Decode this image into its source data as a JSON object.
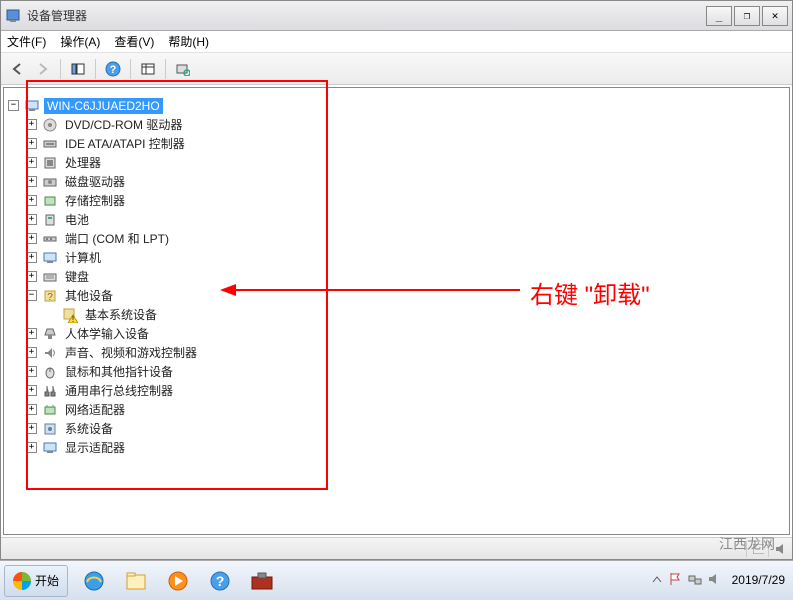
{
  "window": {
    "title": "设备管理器"
  },
  "menubar": {
    "file": "文件(F)",
    "action": "操作(A)",
    "view": "查看(V)",
    "help": "帮助(H)"
  },
  "tree": {
    "root": "WIN-C6JJUAED2HO",
    "items": [
      "DVD/CD-ROM 驱动器",
      "IDE ATA/ATAPI 控制器",
      "处理器",
      "磁盘驱动器",
      "存储控制器",
      "电池",
      "端口 (COM 和 LPT)",
      "计算机",
      "键盘",
      "其他设备",
      "人体学输入设备",
      "声音、视频和游戏控制器",
      "鼠标和其他指针设备",
      "通用串行总线控制器",
      "网络适配器",
      "系统设备",
      "显示适配器"
    ],
    "child_other": "基本系统设备"
  },
  "annotation": {
    "text": "右键 \"卸载\""
  },
  "taskbar": {
    "start": "开始",
    "date": "2019/7/29"
  },
  "watermark": "江西龙网",
  "win_controls": {
    "min": "_",
    "max": "❐",
    "close": "✕"
  }
}
